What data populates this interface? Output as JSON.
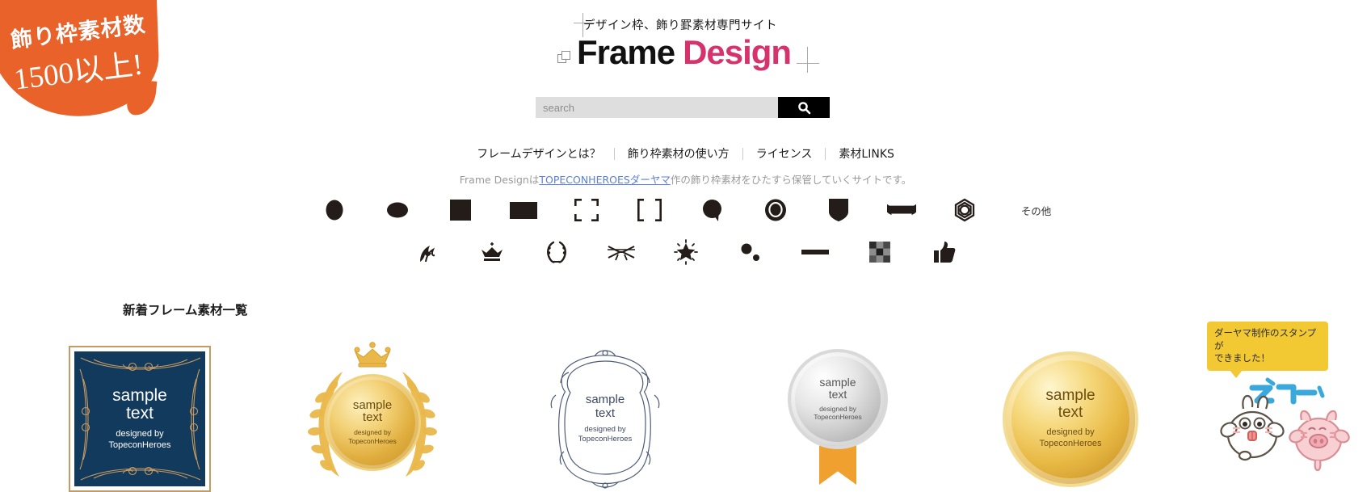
{
  "badge": {
    "line1": "飾り枠素材数",
    "line2": "1500以上!",
    "color": "#e8622a"
  },
  "header": {
    "tagline": "デザイン枠、飾り罫素材専門サイト",
    "logo_part1": "Frame",
    "logo_part2": "Design",
    "logo_accent_color": "#d6326c",
    "logo_mark_icon": "overlapping-squares-icon"
  },
  "search": {
    "placeholder": "search",
    "value": "",
    "button_icon": "search-icon"
  },
  "nav": {
    "items": [
      {
        "label": "フレームデザインとは？"
      },
      {
        "label": "飾り枠素材の使い方"
      },
      {
        "label": "ライセンス"
      },
      {
        "label": "素材LINKS"
      }
    ]
  },
  "description": {
    "before": "Frame Designは",
    "link": "TOPECONHEROESダーヤマ",
    "after": "作の飾り枠素材をひたすら保管していくサイトです。",
    "link_color": "#5b7fd4"
  },
  "category_icons_row1": [
    {
      "name": "ellipse-vertical-icon"
    },
    {
      "name": "ellipse-horizontal-icon"
    },
    {
      "name": "square-icon"
    },
    {
      "name": "rectangle-icon"
    },
    {
      "name": "corner-brackets-icon"
    },
    {
      "name": "square-brackets-icon"
    },
    {
      "name": "speech-bubble-icon"
    },
    {
      "name": "seal-badge-icon"
    },
    {
      "name": "shield-icon"
    },
    {
      "name": "ribbon-banner-icon"
    },
    {
      "name": "rosette-icon"
    }
  ],
  "category_other_label": "その他",
  "category_icons_row2": [
    {
      "name": "flourish-icon"
    },
    {
      "name": "crown-icon"
    },
    {
      "name": "laurel-wreath-icon"
    },
    {
      "name": "ribbon-bow-icon"
    },
    {
      "name": "sparkle-star-icon"
    },
    {
      "name": "dots-icon"
    },
    {
      "name": "line-rule-icon"
    },
    {
      "name": "checker-pattern-icon"
    },
    {
      "name": "thumbs-up-icon"
    }
  ],
  "section": {
    "title": "新着フレーム素材一覧"
  },
  "gallery": {
    "sample_big": "sample",
    "sample_big2": "text",
    "credit_line1": "designed by",
    "credit_line2": "TopeconHeroes",
    "items": [
      {
        "style": "navy-ornate-square-frame"
      },
      {
        "style": "gold-laurel-crown-medal"
      },
      {
        "style": "white-ornate-oval-frame"
      },
      {
        "style": "silver-medal-with-ribbon"
      },
      {
        "style": "gold-round-medal"
      }
    ]
  },
  "promo": {
    "tooltip_line1": "ダーヤマ制作のスタンプが",
    "tooltip_line2": "できました！",
    "tooltip_color": "#f2c933",
    "stamp_text": "ズコーッ",
    "stamp_text_color": "#4cb8e8"
  }
}
